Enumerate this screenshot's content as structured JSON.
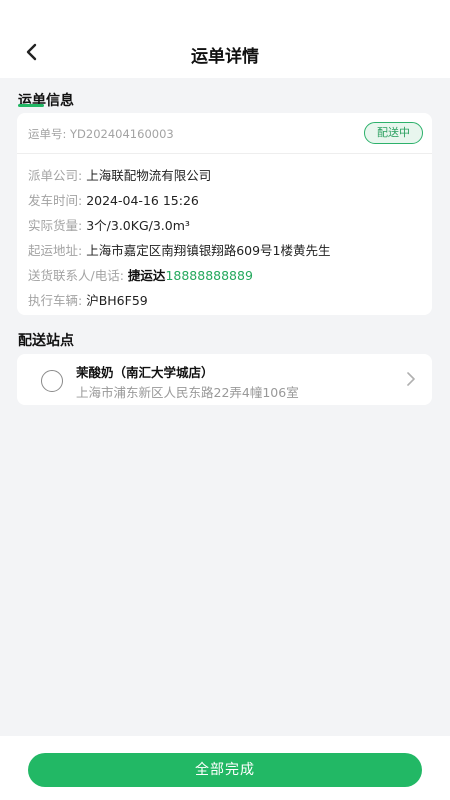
{
  "header": {
    "title": "运单详情"
  },
  "waybill_section": {
    "title": "运单信息",
    "waybill_no_label": "运单号:",
    "waybill_no": "YD202404160003",
    "status": "配送中",
    "rows": [
      {
        "label": "派单公司:",
        "value": "上海联配物流有限公司"
      },
      {
        "label": "发车时间:",
        "value": "2024-04-16 15:26"
      },
      {
        "label": "实际货量:",
        "value": "3个/3.0KG/3.0m³"
      },
      {
        "label": "起运地址:",
        "value": "上海市嘉定区南翔镇银翔路609号1楼黄先生"
      }
    ],
    "contact": {
      "label": "送货联系人/电话:",
      "name": "捷运达",
      "phone": "18888888889"
    },
    "vehicle": {
      "label": "执行车辆:",
      "value": "沪BH6F59"
    }
  },
  "station_section": {
    "title": "配送站点",
    "stations": [
      {
        "name": "茉酸奶（南汇大学城店）",
        "address": "上海市浦东新区人民东路22弄4幢106室"
      }
    ]
  },
  "footer": {
    "complete_label": "全部完成"
  },
  "colors": {
    "accent": "#22b865",
    "page_bg": "#f3f4f6"
  }
}
